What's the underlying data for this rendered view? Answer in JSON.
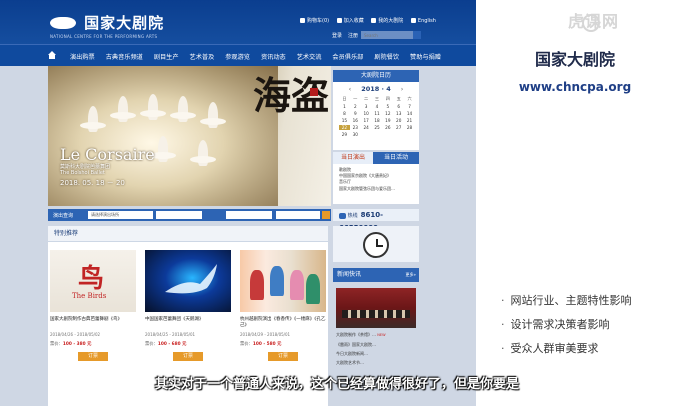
{
  "site": {
    "logo_cn": "国家大剧院",
    "logo_en": "NATIONAL CENTRE FOR THE PERFORMING ARTS",
    "top_links": [
      "购物车(0)",
      "加入收藏",
      "我的大剧院",
      "English"
    ],
    "sub_links": [
      "登录",
      "注册"
    ],
    "search_placeholder": "Search",
    "nav": [
      "演出购票",
      "古典音乐频道",
      "剧目生产",
      "艺术普及",
      "参观游览",
      "资讯动态",
      "艺术交流",
      "会员俱乐部",
      "剧院餐饮",
      "赞助与捐赠"
    ],
    "banner": {
      "title": "Le Corsaire",
      "sub_cn": "莫斯科大剧院芭蕾舞团",
      "sub_en": "The Bolshoi Ballet",
      "dates": "2018. 05. 18 － 20",
      "callig": "海盗"
    },
    "calendar": {
      "header": "大剧院日历",
      "month": "2018 · 4",
      "prev": "‹",
      "next": "›",
      "weekdays": [
        "日",
        "一",
        "二",
        "三",
        "四",
        "五",
        "六"
      ],
      "days": [
        "1",
        "2",
        "3",
        "4",
        "5",
        "6",
        "7",
        "8",
        "9",
        "10",
        "11",
        "12",
        "13",
        "14",
        "15",
        "16",
        "17",
        "18",
        "19",
        "20",
        "21",
        "22",
        "23",
        "24",
        "25",
        "26",
        "27",
        "28",
        "29",
        "30"
      ],
      "tab_today_show": "当日演出",
      "tab_today_event": "当日活动",
      "list": [
        "歌剧院",
        "中国国家京剧院《大唐贵妃》",
        "音乐厅",
        "国家大剧院管弦乐团与爱乐团…"
      ]
    },
    "ticket": {
      "label": "演出查询",
      "box1": "请选择演出场所",
      "hotline_label": "热线",
      "hotline": "8610-66550000"
    },
    "recommend": {
      "header": "特别推荐",
      "cards": [
        {
          "name": "国家大剧院制作古典芭蕾舞剧《鸟》",
          "dates": "2018/04/26 - 2018/05/02",
          "price_label": "票价：",
          "price": "100 - 380 元",
          "buy": "订票",
          "poster_char": "鸟",
          "poster_en": "The Birds"
        },
        {
          "name": "中国国家芭蕾舞团《天鹅湖》",
          "dates": "2018/04/25 - 2018/05/01",
          "price_label": "票价：",
          "price": "100 - 680 元",
          "buy": "订票"
        },
        {
          "name": "杭州越剧院演出《春香传》《一缕麻》《孔乙己》",
          "dates": "2018/04/29 - 2018/05/01",
          "price_label": "票价：",
          "price": "100 - 580 元",
          "buy": "订票"
        }
      ]
    },
    "news": {
      "header": "新闻快讯",
      "more": "更多»",
      "items": [
        "大剧院制作《茶馆》…",
        "《雷雨》国家大剧院…",
        "今日大剧院新闻…",
        "大剧院艺术节…"
      ],
      "new_tag": "NEW"
    }
  },
  "slide": {
    "title": "国家大剧院",
    "url": "www.chncpa.org",
    "bullets": [
      "网站行业、主题特性影响",
      "设计需求决策者影响",
      "受众人群审美要求"
    ],
    "watermark": "虎课网"
  },
  "subtitle": "其实对于一个普通人来说，这个已经算做得很好了，但是你要是"
}
